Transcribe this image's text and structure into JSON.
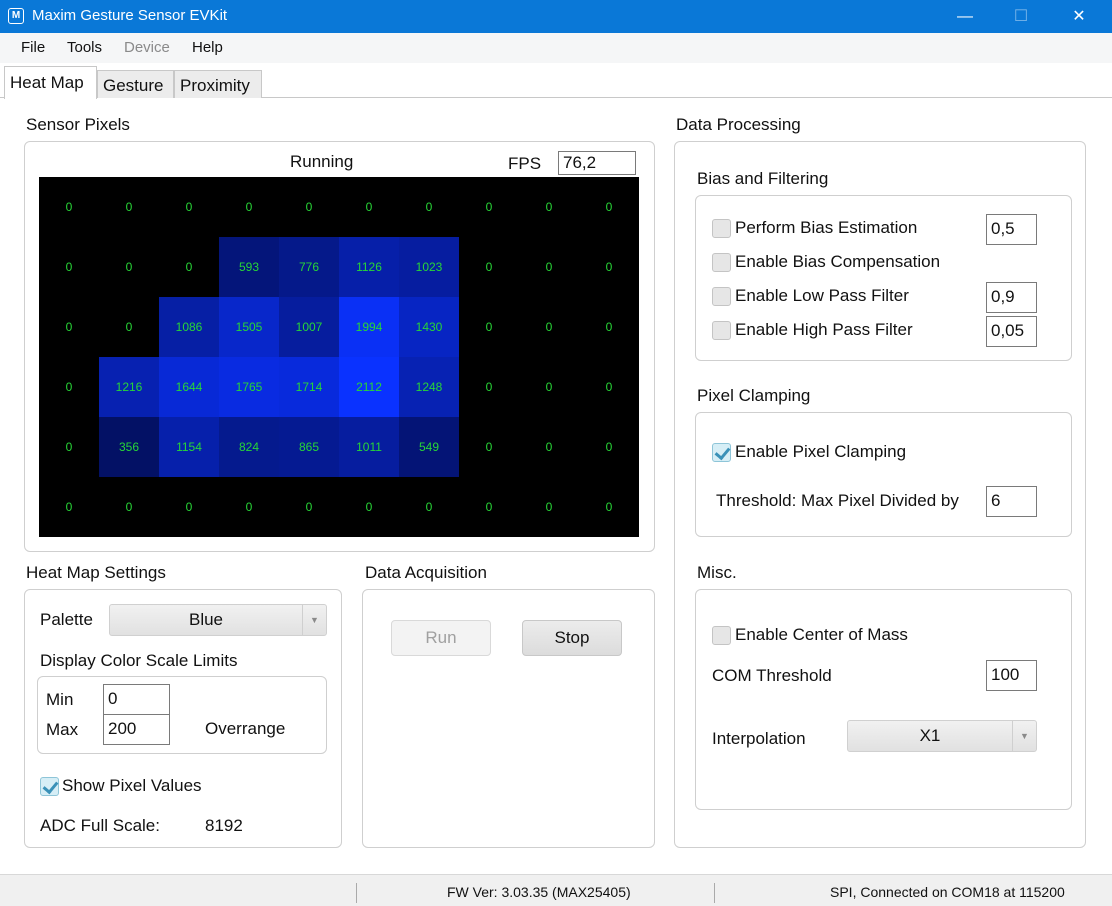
{
  "window": {
    "title": "Maxim Gesture Sensor EVKit",
    "minimize": "—",
    "maximize": "☐",
    "close": "✕"
  },
  "menu": {
    "file": "File",
    "tools": "Tools",
    "device": "Device",
    "help": "Help"
  },
  "tabs": {
    "heat_map": "Heat Map",
    "gesture": "Gesture",
    "proximity": "Proximity"
  },
  "sensor_pixels": {
    "label": "Sensor Pixels",
    "status": "Running",
    "fps_label": "FPS",
    "fps_value": "76,2",
    "grid": [
      [
        0,
        0,
        0,
        0,
        0,
        0,
        0,
        0,
        0,
        0
      ],
      [
        0,
        0,
        0,
        593,
        776,
        1126,
        1023,
        0,
        0,
        0
      ],
      [
        0,
        0,
        1086,
        1505,
        1007,
        1994,
        1430,
        0,
        0,
        0
      ],
      [
        0,
        1216,
        1644,
        1765,
        1714,
        2112,
        1248,
        0,
        0,
        0
      ],
      [
        0,
        356,
        1154,
        824,
        865,
        1011,
        549,
        0,
        0,
        0
      ],
      [
        0,
        0,
        0,
        0,
        0,
        0,
        0,
        0,
        0,
        0
      ]
    ]
  },
  "heat_map_settings": {
    "label": "Heat Map Settings",
    "palette_label": "Palette",
    "palette_value": "Blue",
    "color_scale_label": "Display Color Scale Limits",
    "min_label": "Min",
    "min_value": "0",
    "max_label": "Max",
    "max_value": "200",
    "overrange_label": "Overrange",
    "show_pixel_values": "Show Pixel Values",
    "adc_label": "ADC Full Scale:",
    "adc_value": "8192"
  },
  "data_acquisition": {
    "label": "Data Acquisition",
    "run": "Run",
    "stop": "Stop"
  },
  "data_processing": {
    "label": "Data Processing",
    "bias_label": "Bias and Filtering",
    "bias_estimation": "Perform Bias Estimation",
    "bias_estimation_value": "0,5",
    "bias_compensation": "Enable Bias Compensation",
    "low_pass": "Enable Low Pass Filter",
    "low_pass_value": "0,9",
    "high_pass": "Enable High Pass Filter",
    "high_pass_value": "0,05",
    "clamping_label": "Pixel Clamping",
    "enable_clamping": "Enable Pixel Clamping",
    "threshold_label": "Threshold: Max Pixel Divided by",
    "threshold_value": "6",
    "misc_label": "Misc.",
    "center_of_mass": "Enable Center of Mass",
    "com_threshold_label": "COM Threshold",
    "com_threshold_value": "100",
    "interpolation_label": "Interpolation",
    "interpolation_value": "X1"
  },
  "status_bar": {
    "fw_version": "FW Ver: 3.03.35 (MAX25405)",
    "connection": "SPI, Connected on COM18 at 115200"
  },
  "colors": {
    "titlebar": "#0a78d7",
    "pixel_text": "#27d637",
    "heatmap_bg": "#000000"
  }
}
